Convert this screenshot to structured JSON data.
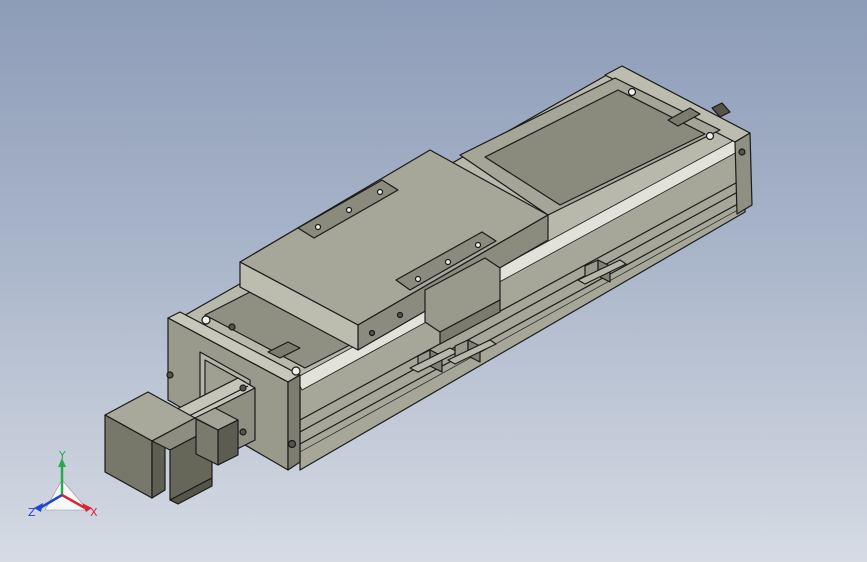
{
  "viewport": {
    "background_top": "#8d9cb8",
    "background_bottom": "#d6dbe4"
  },
  "model": {
    "subject": "linear-actuator-module",
    "color_light": "#c3c3b6",
    "color_mid": "#9e9e8f",
    "color_dark": "#6d6d60",
    "edge_color": "#1a1a1a"
  },
  "triad": {
    "x_label": "X",
    "y_label": "Y",
    "z_label": "Z",
    "x_color": "#d8262e",
    "y_color": "#2aa84a",
    "z_color": "#2244cc"
  }
}
